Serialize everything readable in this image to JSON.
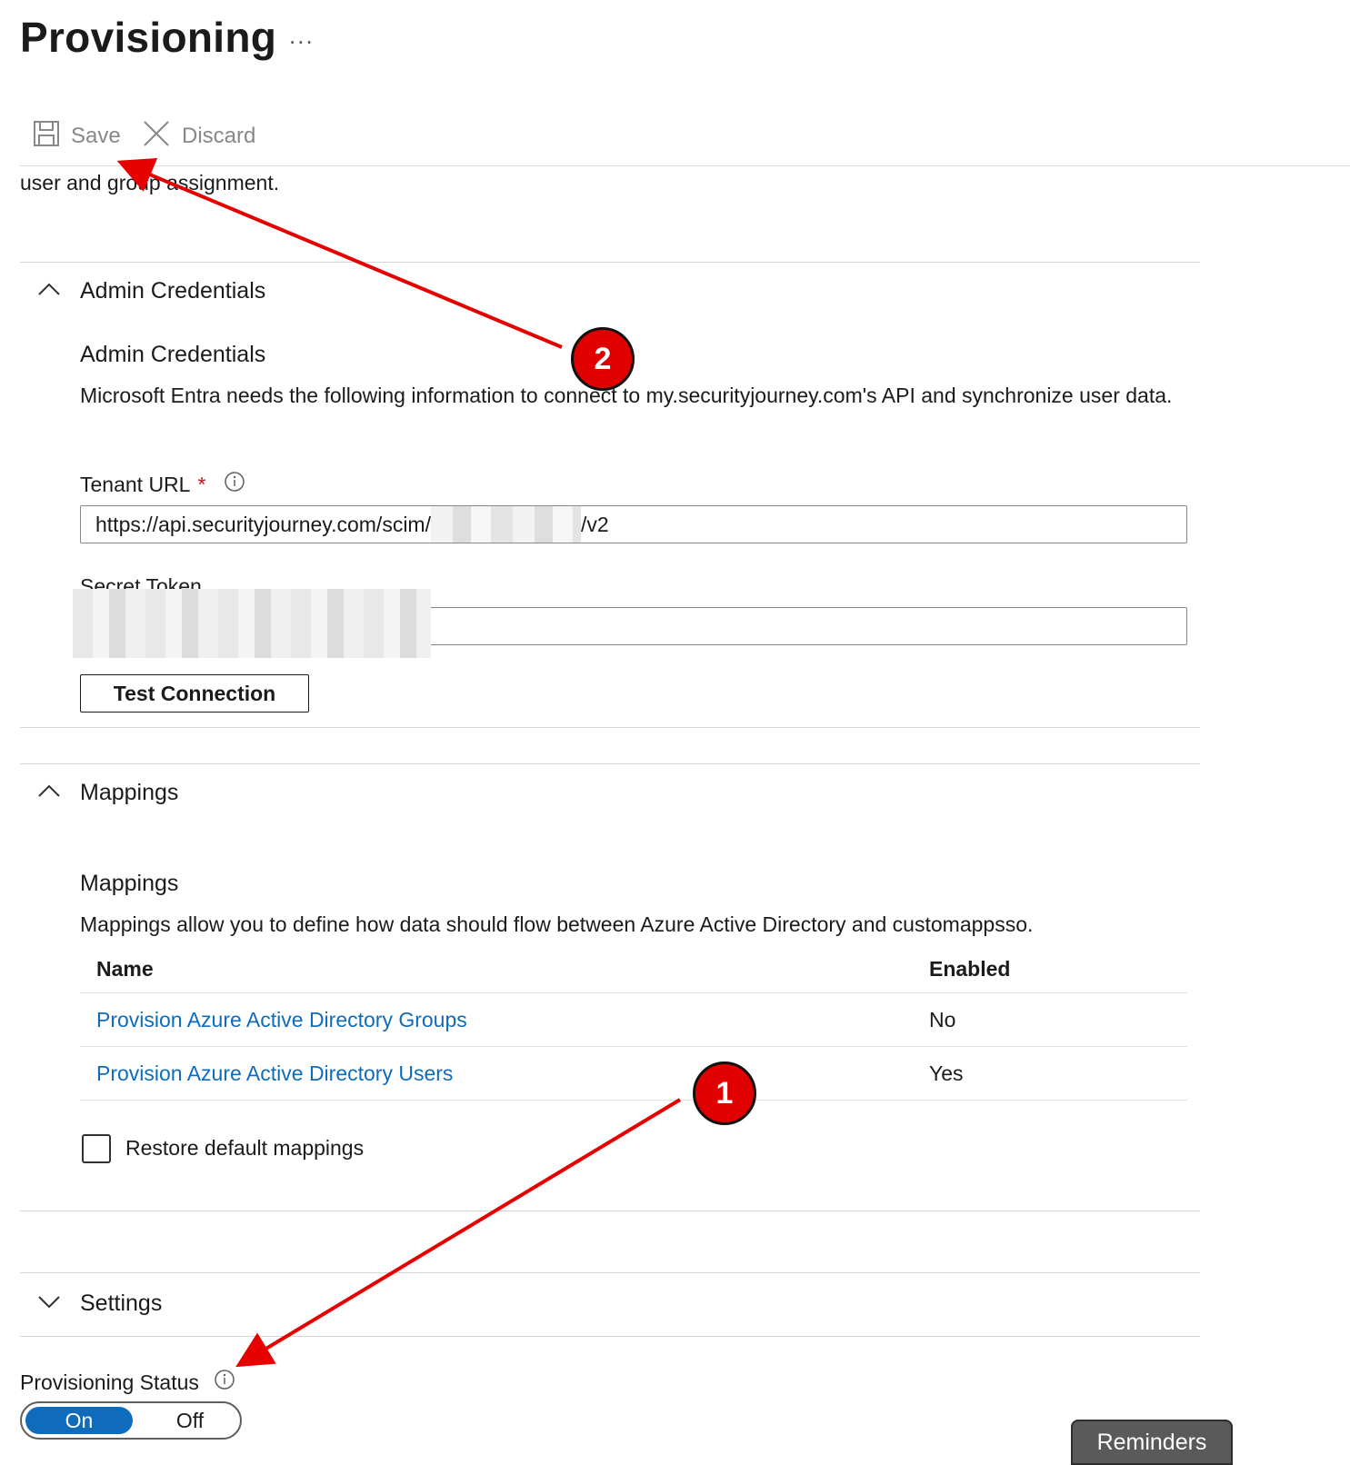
{
  "page": {
    "title": "Provisioning",
    "more_label": "..."
  },
  "toolbar": {
    "save_label": "Save",
    "discard_label": "Discard"
  },
  "intro_text": "user and group assignment.",
  "admin_credentials": {
    "section_label": "Admin Credentials",
    "subtitle": "Admin Credentials",
    "description": "Microsoft Entra needs the following information to connect to my.securityjourney.com's API and synchronize user data.",
    "tenant_url": {
      "label": "Tenant URL",
      "required_mark": "*",
      "value_prefix": "https://api.securityjourney.com/scim/",
      "value_suffix": "/v2"
    },
    "secret_token": {
      "label": "Secret Token"
    },
    "test_button": "Test Connection"
  },
  "mappings": {
    "section_label": "Mappings",
    "subtitle": "Mappings",
    "description": "Mappings allow you to define how data should flow between Azure Active Directory and customappsso.",
    "columns": {
      "name": "Name",
      "enabled": "Enabled"
    },
    "rows": [
      {
        "name": "Provision Azure Active Directory Groups",
        "enabled": "No"
      },
      {
        "name": "Provision Azure Active Directory Users",
        "enabled": "Yes"
      }
    ],
    "restore_label": "Restore default mappings"
  },
  "settings": {
    "section_label": "Settings"
  },
  "provisioning_status": {
    "label": "Provisioning Status",
    "on_label": "On",
    "off_label": "Off",
    "selected": "On"
  },
  "reminders_label": "Reminders",
  "annotations": {
    "marker_1": "1",
    "marker_2": "2",
    "arrow_color": "#e60000"
  },
  "colors": {
    "accent": "#0f6cbd",
    "required": "#c50f1f",
    "annotation": "#e00000"
  }
}
